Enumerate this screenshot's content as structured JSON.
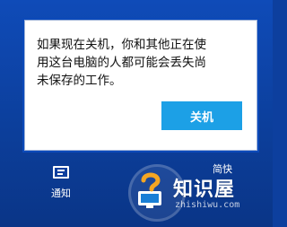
{
  "dialog": {
    "message": "如果现在关机，你和其他正在使\n用这台电脑的人都可能会丢失尚\n未保存的工作。",
    "button_label": "关机"
  },
  "charms": {
    "notify_label": "通知",
    "notify_icon": "notification-icon",
    "settings_label_partial": "简快"
  },
  "watermark": {
    "title": "知识屋",
    "subtitle": "zhishiwu.com",
    "icon": "question-monitor-icon"
  },
  "colors": {
    "background": "#0d3f9e",
    "dialog_bg": "#ffffff",
    "button": "#1ca0e6",
    "badge_orange": "#f5a623"
  }
}
